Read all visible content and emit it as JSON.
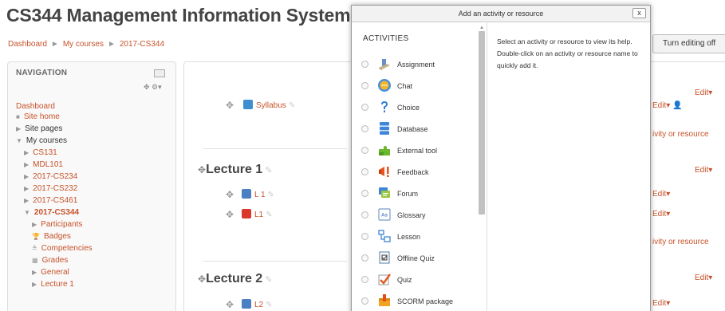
{
  "page": {
    "title": "CS344 Management Information System",
    "breadcrumb": [
      "Dashboard",
      "My courses",
      "2017-CS344"
    ],
    "editing_button": "Turn editing off"
  },
  "navigation": {
    "title": "NAVIGATION",
    "items": [
      {
        "label": "Dashboard"
      },
      {
        "label": "Site home"
      },
      {
        "label": "Site pages"
      },
      {
        "label": "My courses"
      },
      {
        "label": "CS131"
      },
      {
        "label": "MDL101"
      },
      {
        "label": "2017-CS234"
      },
      {
        "label": "2017-CS232"
      },
      {
        "label": "2017-CS461"
      },
      {
        "label": "2017-CS344"
      },
      {
        "label": "Participants"
      },
      {
        "label": "Badges"
      },
      {
        "label": "Competencies"
      },
      {
        "label": "Grades"
      },
      {
        "label": "General"
      },
      {
        "label": "Lecture 1"
      }
    ]
  },
  "course": {
    "syllabus": "Syllabus",
    "lecture1": {
      "title": "Lecture 1",
      "items": [
        "L 1",
        "L1"
      ]
    },
    "lecture2": {
      "title": "Lecture 2",
      "items": [
        "L2"
      ]
    },
    "edit": "Edit",
    "add_link_partial": "ivity or resource"
  },
  "modal": {
    "title": "Add an activity or resource",
    "close": "x",
    "heading": "ACTIVITIES",
    "help": "Select an activity or resource to view its help. Double-click on an activity or resource name to quickly add it.",
    "options": [
      {
        "label": "Assignment",
        "icon": "assignment-icon"
      },
      {
        "label": "Chat",
        "icon": "chat-icon"
      },
      {
        "label": "Choice",
        "icon": "choice-icon"
      },
      {
        "label": "Database",
        "icon": "database-icon"
      },
      {
        "label": "External tool",
        "icon": "external-tool-icon"
      },
      {
        "label": "Feedback",
        "icon": "feedback-icon"
      },
      {
        "label": "Forum",
        "icon": "forum-icon"
      },
      {
        "label": "Glossary",
        "icon": "glossary-icon"
      },
      {
        "label": "Lesson",
        "icon": "lesson-icon"
      },
      {
        "label": "Offline Quiz",
        "icon": "offline-quiz-icon"
      },
      {
        "label": "Quiz",
        "icon": "quiz-icon"
      },
      {
        "label": "SCORM package",
        "icon": "scorm-package-icon"
      }
    ]
  },
  "colors": {
    "link": "#c7522a",
    "title": "#444444"
  }
}
